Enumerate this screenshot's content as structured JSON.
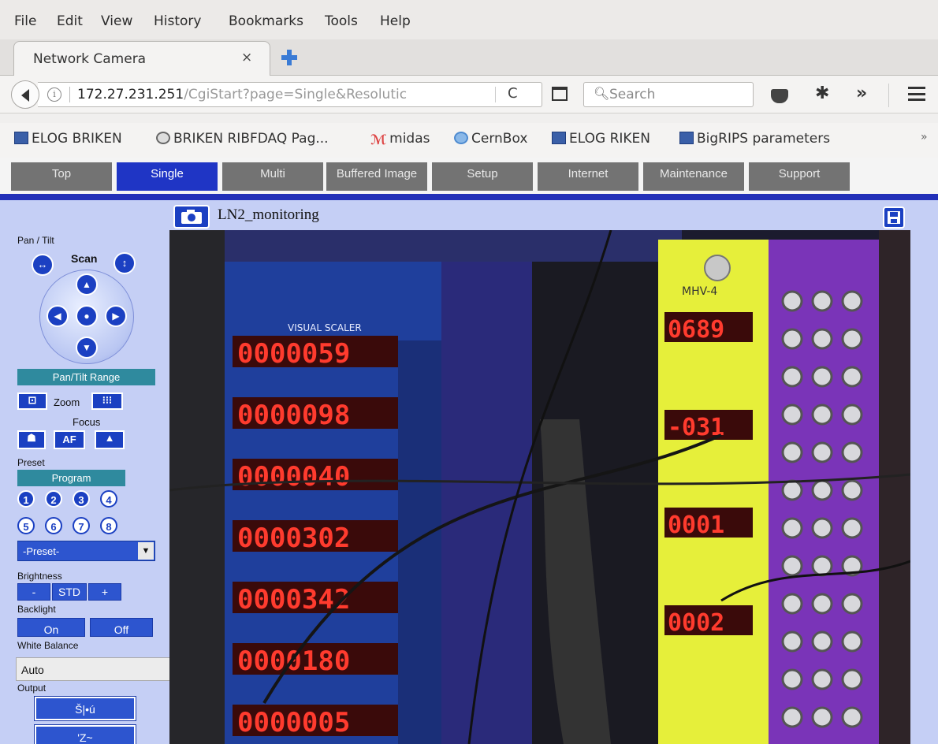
{
  "menu": [
    {
      "label": "File"
    },
    {
      "label": "Edit"
    },
    {
      "label": "View"
    },
    {
      "label": "History"
    },
    {
      "label": "Bookmarks"
    },
    {
      "label": "Tools"
    },
    {
      "label": "Help"
    }
  ],
  "tab": {
    "title": "Network Camera",
    "close": "×"
  },
  "nav": {
    "url_host": "172.27.231.251",
    "url_path": "/CgiStart?page=Single&Resolutic",
    "search_placeholder": "Search",
    "reload": "C",
    "overflow": "»"
  },
  "bookmarks": [
    {
      "label": "ELOG BRIKEN",
      "icon": "elog-icon"
    },
    {
      "label": "BRIKEN RIBFDAQ Pag...",
      "icon": "globe-icon"
    },
    {
      "label": "midas",
      "icon": "midas-icon"
    },
    {
      "label": "CernBox",
      "icon": "cernbox-icon"
    },
    {
      "label": "ELOG RIKEN",
      "icon": "elog-icon"
    },
    {
      "label": "BigRIPS parameters",
      "icon": "elog-icon"
    }
  ],
  "bookmarks_more": "»",
  "cam_tabs": [
    {
      "label": "Top",
      "active": false
    },
    {
      "label": "Single",
      "active": true
    },
    {
      "label": "Multi",
      "active": false
    },
    {
      "label": "Buffered Image",
      "active": false
    },
    {
      "label": "Setup",
      "active": false
    },
    {
      "label": "Internet",
      "active": false
    },
    {
      "label": "Maintenance",
      "active": false
    },
    {
      "label": "Support",
      "active": false
    }
  ],
  "camera": {
    "title": "LN2_monitoring"
  },
  "panel": {
    "pan_tilt": "Pan / Tilt",
    "scan": "Scan",
    "pan_tilt_range": "Pan/Tilt Range",
    "zoom": "Zoom",
    "focus": "Focus",
    "focus_af": "AF",
    "preset": "Preset",
    "program": "Program",
    "preset_numbers": [
      "1",
      "2",
      "3",
      "4",
      "5",
      "6",
      "7",
      "8"
    ],
    "preset_select": "-Preset-",
    "brightness": "Brightness",
    "brightness_minus": "-",
    "brightness_std": "STD",
    "brightness_plus": "+",
    "backlight": "Backlight",
    "backlight_on": "On",
    "backlight_off": "Off",
    "white_balance": "White Balance",
    "white_balance_value": "Auto",
    "output": "Output",
    "output_btn1": "Š|•ú",
    "output_btn2": "'Z~"
  },
  "scene": {
    "scaler_label": "VISUAL SCALER",
    "scaler_digits": [
      "0000059",
      "0000098",
      "0000040",
      "0000302",
      "0000342",
      "0000180",
      "0000005"
    ],
    "hv_digits": [
      "0689",
      "-031",
      "0001",
      "0002"
    ],
    "hv_label": "MHV-4",
    "colors": {
      "led": "#ff3b2e",
      "yellow_module": "#e6ef3a",
      "purple_module": "#7a34b8",
      "blue_panel": "#1f3f9c"
    }
  }
}
